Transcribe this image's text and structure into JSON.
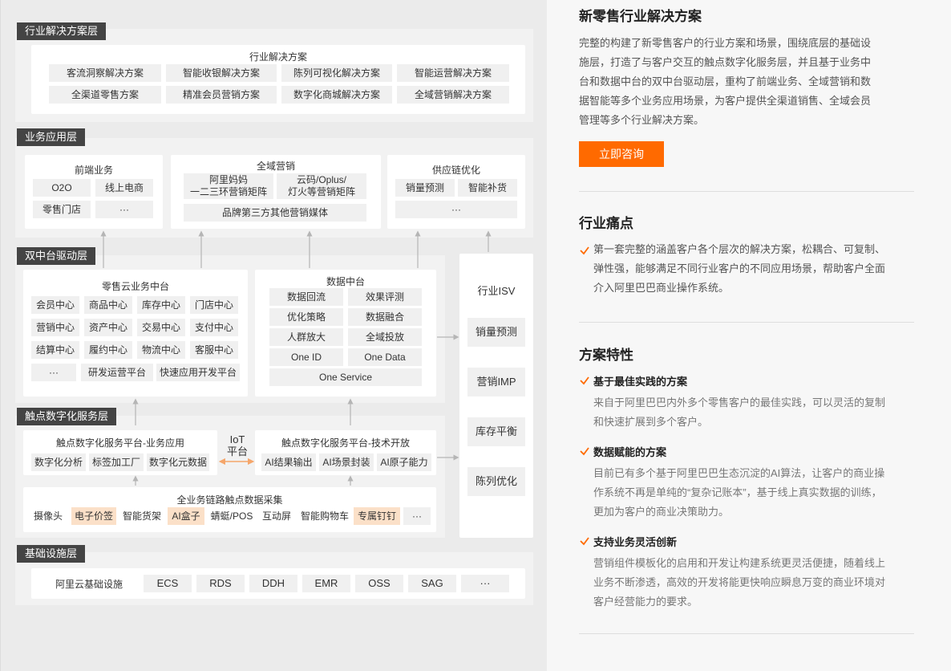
{
  "layers": {
    "industry": "行业解决方案层",
    "business": "业务应用层",
    "dual": "双中台驱动层",
    "touch": "触点数字化服务层",
    "infra": "基础设施层"
  },
  "industry_card": {
    "title": "行业解决方案",
    "items": [
      "客流洞察解决方案",
      "智能收银解决方案",
      "陈列可视化解决方案",
      "智能运营解决方案",
      "全渠道零售方案",
      "精准会员营销方案",
      "数字化商城解决方案",
      "全域营销解决方案"
    ]
  },
  "frontend": {
    "title": "前端业务",
    "items": [
      "O2O",
      "线上电商",
      "零售门店",
      "···"
    ]
  },
  "marketing": {
    "title": "全域营销",
    "items": [
      "阿里妈妈\n一二三环营销矩阵",
      "云码/Oplus/\n灯火等营销矩阵",
      "品牌第三方其他营销媒体"
    ]
  },
  "supply": {
    "title": "供应链优化",
    "items": [
      "销量预测",
      "智能补货",
      "···"
    ]
  },
  "retail_mid": {
    "title": "零售云业务中台",
    "items": [
      "会员中心",
      "商品中心",
      "库存中心",
      "门店中心",
      "营销中心",
      "资产中心",
      "交易中心",
      "支付中心",
      "结算中心",
      "履约中心",
      "物流中心",
      "客服中心",
      "···",
      "研发运营平台",
      "快速应用开发平台"
    ]
  },
  "data_mid": {
    "title": "数据中台",
    "items": [
      "数据回流",
      "效果评测",
      "优化策略",
      "数据融合",
      "人群放大",
      "全域投放",
      "One ID",
      "One Data",
      "One Service"
    ]
  },
  "isv": {
    "title": "行业ISV",
    "items": [
      "销量预测",
      "营销IMP",
      "库存平衡",
      "陈列优化"
    ]
  },
  "touch_biz": {
    "title": "触点数字化服务平台-业务应用",
    "items": [
      "数字化分析",
      "标签加工厂",
      "数字化元数据"
    ]
  },
  "iot": "IoT\n平台",
  "touch_tech": {
    "title": "触点数字化服务平台-技术开放",
    "items": [
      "AI结果输出",
      "AI场景封装",
      "AI原子能力"
    ]
  },
  "collection": {
    "title": "全业务链路触点数据采集",
    "items": [
      "摄像头",
      "电子价签",
      "智能货架",
      "AI盒子",
      "蜻蜓/POS",
      "互动屏",
      "智能购物车",
      "专属钉钉",
      "···"
    ]
  },
  "infra": {
    "title": "阿里云基础设施",
    "items": [
      "ECS",
      "RDS",
      "DDH",
      "EMR",
      "OSS",
      "SAG",
      "···"
    ]
  },
  "right": {
    "title": "新零售行业解决方案",
    "desc_lines": [
      "完整的构建了新零售客户的行业方案和场景，围绕底层的基础设",
      "施层，打造了与客户交互的触点数字化服务层，并且基于业务中",
      "台和数据中台的双中台驱动层，重构了前端业务、全域营销和数",
      "据智能等多个业务应用场景，为客户提供全渠道销售、全域会员",
      "管理等多个行业解决方案。"
    ],
    "button": "立即咨询",
    "pain_title": "行业痛点",
    "pain_lines": [
      "第一套完整的涵盖客户各个层次的解决方案，松耦合、可复制、",
      "弹性强，能够满足不同行业客户的不同应用场景，帮助客户全面",
      "介入阿里巴巴商业操作系统。"
    ],
    "feature_title": "方案特性",
    "features": [
      {
        "title": "基于最佳实践的方案",
        "lines": [
          "来自于阿里巴巴内外多个零售客户的最佳实践，可以灵活的复制",
          "和快速扩展到多个客户。"
        ]
      },
      {
        "title": "数据赋能的方案",
        "lines": [
          "目前已有多个基于阿里巴巴生态沉淀的AI算法，让客户的商业操",
          "作系统不再是单纯的“复杂记账本”，基于线上真实数据的训练，",
          "更加为客户的商业决策助力。"
        ]
      },
      {
        "title": "支持业务灵活创新",
        "lines": [
          "营销组件模板化的启用和开发让构建系统更灵活便捷，随着线上",
          "业务不断渗透，高效的开发将能更快响应瞬息万变的商业环境对",
          "客户经营能力的要求。"
        ]
      }
    ]
  },
  "colors": {
    "accent": "#ff6a00",
    "tag": "#444444",
    "chip_orange": "#fbe0c8"
  }
}
